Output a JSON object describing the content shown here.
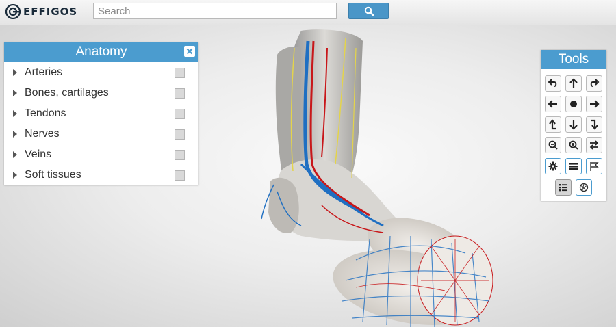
{
  "header": {
    "logo_text": "EFFIGOS",
    "search": {
      "placeholder": "Search",
      "value": ""
    },
    "search_icon": "magnifier-icon"
  },
  "anatomy_panel": {
    "title": "Anatomy",
    "close_icon": "close-icon",
    "items": [
      {
        "label": "Arteries",
        "checked": false
      },
      {
        "label": "Bones, cartilages",
        "checked": false
      },
      {
        "label": "Tendons",
        "checked": false
      },
      {
        "label": "Nerves",
        "checked": false
      },
      {
        "label": "Veins",
        "checked": false
      },
      {
        "label": "Soft tissues",
        "checked": false
      }
    ]
  },
  "tools_panel": {
    "title": "Tools",
    "buttons": [
      "rotate-left-icon",
      "up-icon",
      "rotate-right-icon",
      "left-icon",
      "center-icon",
      "right-icon",
      "turn-up-icon",
      "down-icon",
      "turn-down-icon",
      "zoom-out-icon",
      "zoom-in-icon",
      "swap-icon",
      "settings-icon",
      "layers-icon",
      "flag-icon",
      "list-icon",
      "ball-icon"
    ]
  },
  "colors": {
    "accent": "#4b9ccf",
    "artery": "#c8171a",
    "vein": "#1f6fc2",
    "nerve": "#e4d44a"
  }
}
